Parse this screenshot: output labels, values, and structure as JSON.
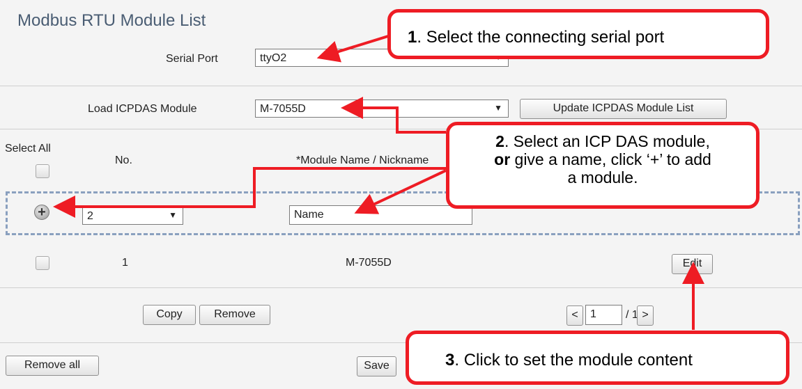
{
  "title": "Modbus RTU Module List",
  "serial_port": {
    "label": "Serial Port",
    "value": "ttyO2"
  },
  "load_module": {
    "label": "Load ICPDAS Module",
    "value": "M-7055D",
    "update_button": "Update ICPDAS Module List"
  },
  "table": {
    "select_all": "Select All",
    "col_no": "No.",
    "col_name": "*Module Name / Nickname"
  },
  "add_row": {
    "plus": "+",
    "no_value": "2",
    "name_placeholder": "Name"
  },
  "rows": [
    {
      "no": "1",
      "name": "M-7055D",
      "edit": "Edit"
    }
  ],
  "actions": {
    "copy": "Copy",
    "remove": "Remove",
    "remove_all": "Remove all",
    "save": "Save"
  },
  "pagination": {
    "prev": "<",
    "page": "1",
    "total": "/ 1",
    "next": ">"
  },
  "callouts": [
    {
      "num": "1",
      "text": ". Select the connecting serial port"
    },
    {
      "num": "2",
      "line1": ". Select an ICP DAS module,",
      "or": "or",
      "line2": " give a name, click ‘+’ to add",
      "line3": "a module."
    },
    {
      "num": "3",
      "text": ". Click to set the module content"
    }
  ],
  "colors": {
    "accent_red": "#ee1c24",
    "title_color": "#4a5d73",
    "dash_border": "#8aa0bf"
  }
}
